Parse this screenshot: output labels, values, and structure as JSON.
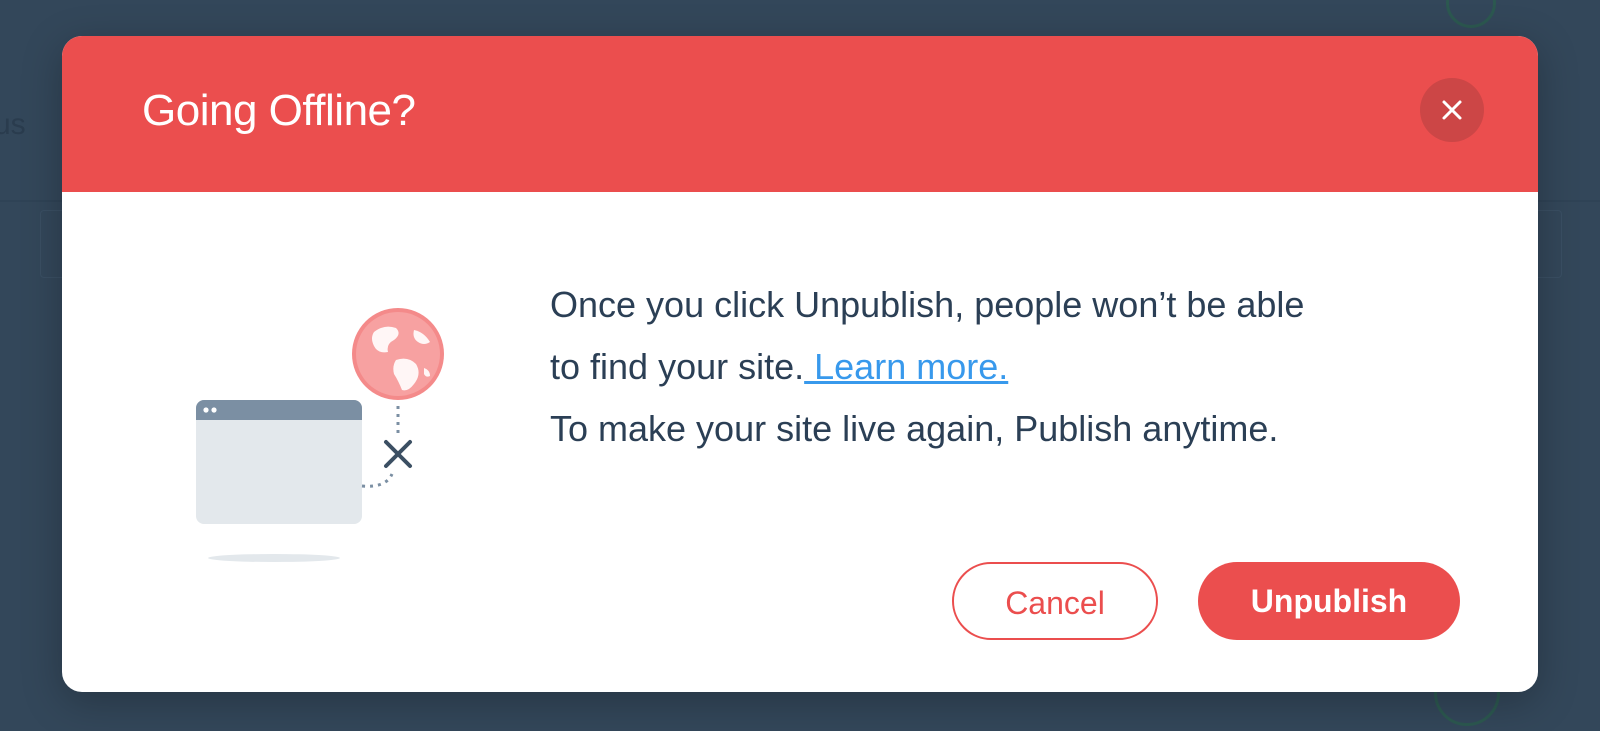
{
  "background": {
    "partial_text": "us"
  },
  "dialog": {
    "title": "Going Offline?",
    "close_label": "close",
    "message": {
      "line1": "Once you click Unpublish, people won’t be able",
      "line2_prefix": "to find your site.",
      "learn_more": " Learn more.",
      "line3": "To make your site live again, Publish anytime."
    },
    "buttons": {
      "cancel": "Cancel",
      "unpublish": "Unpublish"
    },
    "illustration": {
      "icons": [
        "browser-window-icon",
        "globe-icon",
        "disconnect-x-icon"
      ]
    }
  },
  "colors": {
    "accent": "#eb4e4e",
    "accent_dark": "#cc4646",
    "link": "#3899ec",
    "text": "#2b3f55",
    "backdrop": "#33475a"
  }
}
